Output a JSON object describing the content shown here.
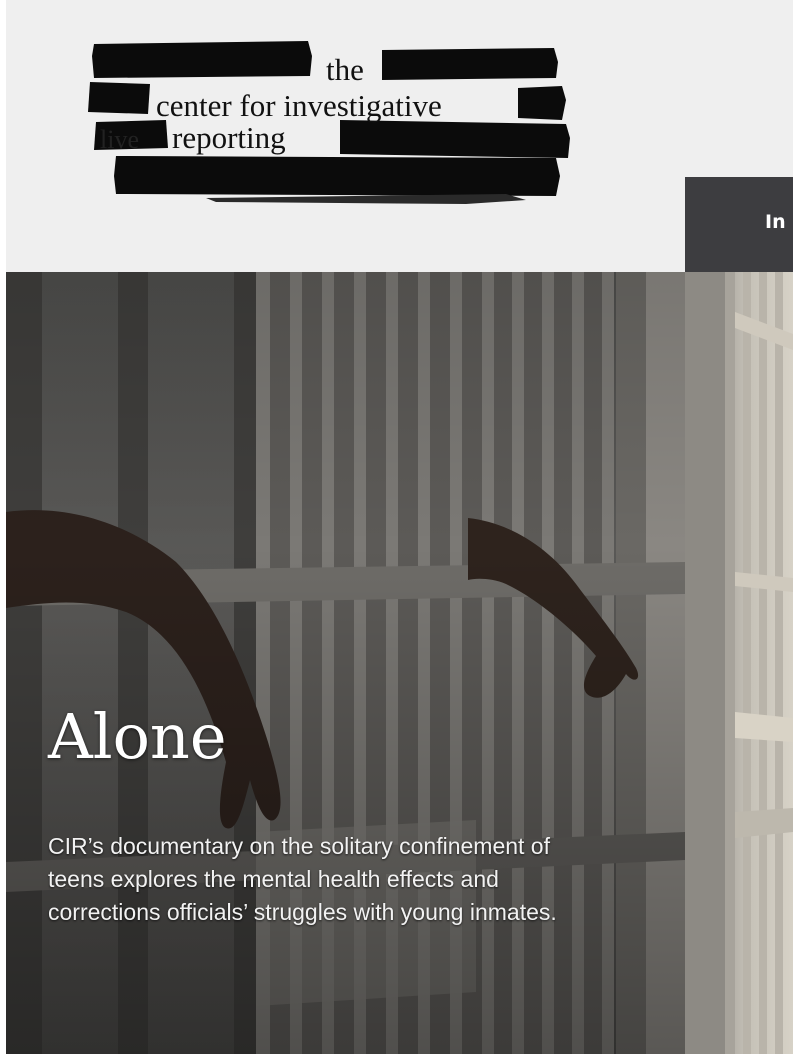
{
  "header": {
    "logo": {
      "line_the": "the",
      "line_center": "center for investigative",
      "line_live": "live",
      "line_reporting": "reporting"
    },
    "nav_tab_label": "In"
  },
  "hero": {
    "title": "Alone",
    "description": "CIR’s documentary on the solitary confinement of teens explores the mental health effects and corrections officials’ struggles with young inmates."
  },
  "colors": {
    "header_bg": "#efefef",
    "nav_tab_bg": "#3d3d40",
    "hero_text": "#ffffff"
  }
}
